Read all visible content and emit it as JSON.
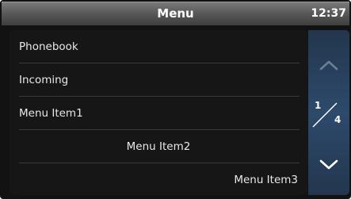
{
  "header": {
    "title": "Menu",
    "time": "12:37"
  },
  "menu": {
    "items": [
      {
        "label": "Phonebook"
      },
      {
        "label": "Incoming"
      },
      {
        "label": "Menu Item1"
      },
      {
        "label": "Menu Item2"
      },
      {
        "label": "Menu Item3"
      }
    ]
  },
  "pager": {
    "current": "1",
    "total": "4"
  },
  "icons": {
    "up": "chevron-up-icon",
    "down": "chevron-down-icon"
  }
}
